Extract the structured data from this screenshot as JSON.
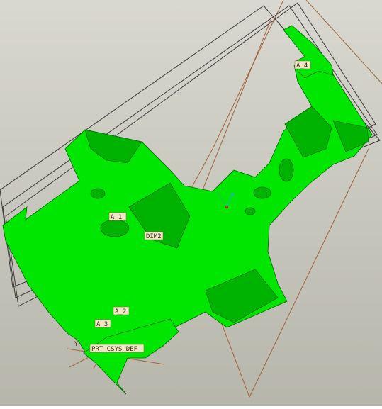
{
  "viewport": {
    "background_top": "#d9d8d0",
    "background_bottom": "#b7b6ab",
    "part_color": "#00e600",
    "part_shade": "#00b300",
    "part_edge": "#006600",
    "datum_plane_color": "#3c3c3c",
    "datum_curve_color": "#a0643c",
    "label_bg": "#f0e6c8",
    "label_border": "#8a6a30"
  },
  "labels": {
    "a1": "A_1",
    "a2": "A_2",
    "a3": "A_3",
    "a4": "A_4",
    "dim2": "DIM2",
    "csys": "PRT_CSYS_DEF",
    "csys_y": "Y"
  }
}
